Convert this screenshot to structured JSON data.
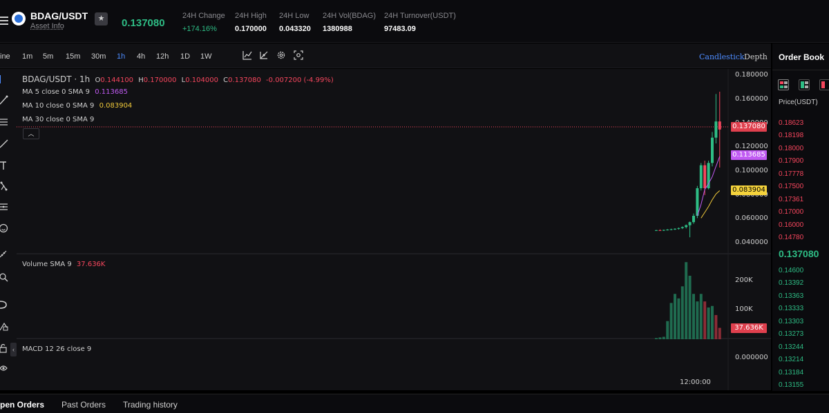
{
  "header": {
    "pair": "BDAG/USDT",
    "asset_info": "Asset Info",
    "last_price": "0.137080",
    "stats": [
      {
        "label": "24H Change",
        "value": "+174.16%"
      },
      {
        "label": "24H High",
        "value": "0.170000"
      },
      {
        "label": "24H Low",
        "value": "0.043320"
      },
      {
        "label": "24H Vol(BDAG)",
        "value": "1380988"
      },
      {
        "label": "24H Turnover(USDT)",
        "value": "97483.09"
      }
    ]
  },
  "toolbar": {
    "line_label": "ine",
    "intervals": [
      "1m",
      "5m",
      "15m",
      "30m",
      "1h",
      "4h",
      "12h",
      "1D",
      "1W"
    ],
    "active_interval": "1h",
    "tool_icons": [
      "indicator-icon",
      "drawing-icon",
      "settings-icon",
      "screenshot-icon"
    ],
    "chart_types": [
      "Candlestick",
      "Depth"
    ],
    "active_chart_type": "Candlestick"
  },
  "left_tools": [
    "cursor-icon",
    "trendline-icon",
    "fib-icon",
    "brush-icon",
    "text-icon",
    "pattern-icon",
    "measure-icon",
    "emoji-icon",
    "ruler-icon",
    "zoom-icon",
    "magnet-icon",
    "lock-drawing-icon",
    "lock-icon",
    "eye-icon"
  ],
  "legend": {
    "title": "BDAG/USDT · 1h",
    "ohlc": [
      {
        "k": "O",
        "v": "0.144100"
      },
      {
        "k": "H",
        "v": "0.170000"
      },
      {
        "k": "L",
        "v": "0.104000"
      },
      {
        "k": "C",
        "v": "0.137080"
      }
    ],
    "change": "-0.007200 (-4.99%)",
    "ma5_label": "MA 5 close 0 SMA 9",
    "ma5_value": "0.113685",
    "ma10_label": "MA 10 close 0 SMA 9",
    "ma10_value": "0.083904",
    "ma30_label": "MA 30 close 0 SMA 9",
    "volume_label": "Volume SMA 9",
    "volume_value": "37.636K",
    "macd_label": "MACD 12 26 close 9"
  },
  "axis": {
    "price_ticks": [
      "0.180000",
      "0.160000",
      "0.140000",
      "0.120000",
      "0.100000",
      "0.080000",
      "0.060000",
      "0.040000"
    ],
    "volume_ticks": [
      "200K",
      "100K"
    ],
    "macd_ticks": [
      "0.000000"
    ],
    "time_tick": "12:00:00"
  },
  "tags": {
    "price": "0.137080",
    "ma5": "0.113685",
    "ma10": "0.083904",
    "volume": "37.636K"
  },
  "colors": {
    "up": "#2ebd85",
    "down": "#f6465d",
    "ma5": "#c15bf3",
    "ma10": "#f0c93a",
    "accent": "#4d8cff"
  },
  "chart_data": {
    "type": "candlestick",
    "interval": "1h",
    "ylim": [
      0.035,
      0.185
    ],
    "candles": [
      {
        "o": 0.0493,
        "h": 0.0498,
        "l": 0.0489,
        "c": 0.0495
      },
      {
        "o": 0.0495,
        "h": 0.0502,
        "l": 0.049,
        "c": 0.0492
      },
      {
        "o": 0.0492,
        "h": 0.05,
        "l": 0.0488,
        "c": 0.0497
      },
      {
        "o": 0.0497,
        "h": 0.0505,
        "l": 0.0492,
        "c": 0.05
      },
      {
        "o": 0.05,
        "h": 0.0508,
        "l": 0.0494,
        "c": 0.0503
      },
      {
        "o": 0.0503,
        "h": 0.0512,
        "l": 0.0497,
        "c": 0.0507
      },
      {
        "o": 0.0507,
        "h": 0.0518,
        "l": 0.05,
        "c": 0.0513
      },
      {
        "o": 0.0513,
        "h": 0.0528,
        "l": 0.0505,
        "c": 0.0522
      },
      {
        "o": 0.0522,
        "h": 0.0545,
        "l": 0.051,
        "c": 0.0538
      },
      {
        "o": 0.0538,
        "h": 0.057,
        "l": 0.0433,
        "c": 0.0565
      },
      {
        "o": 0.0565,
        "h": 0.064,
        "l": 0.055,
        "c": 0.062
      },
      {
        "o": 0.062,
        "h": 0.088,
        "l": 0.06,
        "c": 0.086
      },
      {
        "o": 0.086,
        "h": 0.108,
        "l": 0.084,
        "c": 0.106
      },
      {
        "o": 0.106,
        "h": 0.11,
        "l": 0.08,
        "c": 0.086
      },
      {
        "o": 0.086,
        "h": 0.11,
        "l": 0.085,
        "c": 0.108
      },
      {
        "o": 0.108,
        "h": 0.135,
        "l": 0.105,
        "c": 0.13
      },
      {
        "o": 0.13,
        "h": 0.168,
        "l": 0.125,
        "c": 0.1441
      },
      {
        "o": 0.1441,
        "h": 0.17,
        "l": 0.104,
        "c": 0.1371
      }
    ],
    "ma5": [
      null,
      null,
      null,
      null,
      null,
      null,
      null,
      null,
      null,
      null,
      null,
      0.062,
      0.072,
      0.085,
      0.09,
      0.096,
      0.105,
      0.1137
    ],
    "ma10": [
      null,
      null,
      null,
      null,
      null,
      null,
      null,
      null,
      null,
      null,
      null,
      null,
      0.06,
      0.065,
      0.07,
      0.076,
      0.081,
      0.0839
    ],
    "volume": [
      4000,
      6000,
      8000,
      60000,
      120000,
      150000,
      135000,
      175000,
      255000,
      210000,
      150000,
      125000,
      150000,
      125000,
      105000,
      110000,
      80000,
      37636
    ],
    "volume_ylim": [
      0,
      260000
    ],
    "volume_up": [
      true,
      true,
      true,
      true,
      true,
      true,
      true,
      true,
      true,
      true,
      true,
      true,
      true,
      false,
      true,
      true,
      false,
      false
    ]
  },
  "orderbook": {
    "title": "Order Book",
    "price_header": "Price(USDT)",
    "asks": [
      "0.18623",
      "0.18198",
      "0.18000",
      "0.17900",
      "0.17778",
      "0.17500",
      "0.17361",
      "0.17000",
      "0.16000",
      "0.14780"
    ],
    "mid": "0.137080",
    "bids": [
      "0.14600",
      "0.13392",
      "0.13363",
      "0.13333",
      "0.13303",
      "0.13273",
      "0.13244",
      "0.13214",
      "0.13184",
      "0.13155"
    ]
  },
  "bottom_tabs": [
    "pen Orders",
    "Past Orders",
    "Trading history"
  ]
}
